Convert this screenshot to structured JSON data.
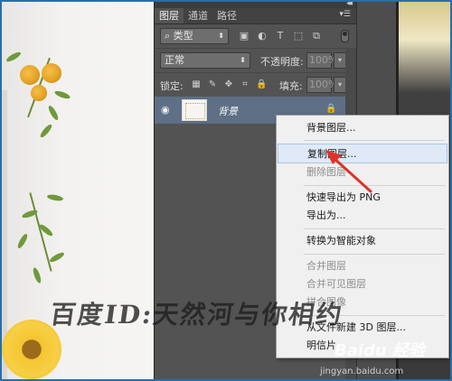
{
  "layers_panel": {
    "tabs": [
      {
        "label": "图层",
        "active": true
      },
      {
        "label": "通道",
        "active": false
      },
      {
        "label": "路径",
        "active": false
      }
    ],
    "filter": {
      "label": "类型"
    },
    "filter_icons": [
      "image-icon",
      "adjustment-icon",
      "text-icon",
      "shape-icon",
      "smart-object-icon"
    ],
    "blend_mode": "正常",
    "opacity_label": "不透明度:",
    "opacity_value": "100%",
    "lock_label": "锁定:",
    "fill_label": "填充:",
    "fill_value": "100%",
    "layers": [
      {
        "name": "背景",
        "visible": true,
        "locked": true
      }
    ]
  },
  "context_menu": {
    "items": [
      {
        "label": "背景图层...",
        "enabled": true
      },
      {
        "label": "复制图层...",
        "enabled": true,
        "highlighted": true
      },
      {
        "label": "删除图层",
        "enabled": false
      },
      {
        "label": "快速导出为 PNG",
        "enabled": true
      },
      {
        "label": "导出为...",
        "enabled": true
      },
      {
        "label": "转换为智能对象",
        "enabled": true
      },
      {
        "label": "合并图层",
        "enabled": false
      },
      {
        "label": "合并可见图层",
        "enabled": false
      },
      {
        "label": "拼合图像",
        "enabled": false
      },
      {
        "label": "从文件新建 3D 图层...",
        "enabled": true
      },
      {
        "label": "明信片",
        "enabled": true
      }
    ]
  },
  "watermark": {
    "text": "百度ID:天然河与你相约",
    "logo": "Baidu 经验",
    "site": "jingyan.baidu.com"
  },
  "colors": {
    "panel_bg": "#535353",
    "selected_layer": "#5e6f86",
    "menu_highlight": "#dfe9f7",
    "annotation_red": "#e0322a"
  }
}
